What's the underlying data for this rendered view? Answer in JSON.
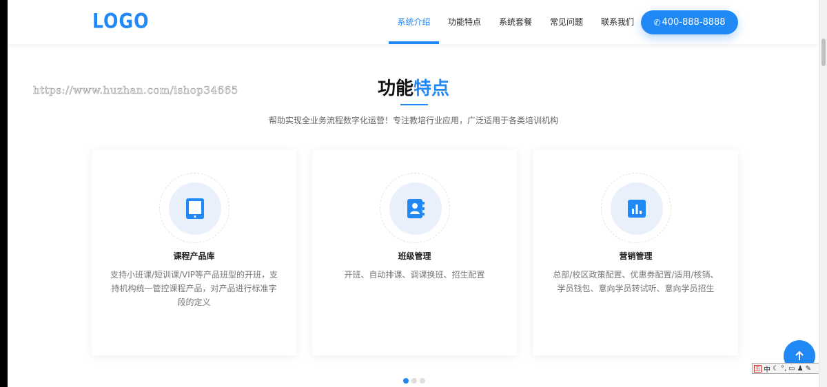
{
  "header": {
    "logo": "LOGO",
    "nav": [
      {
        "label": "系统介绍",
        "active": true
      },
      {
        "label": "功能特点",
        "active": false
      },
      {
        "label": "系统套餐",
        "active": false
      },
      {
        "label": "常见问题",
        "active": false
      },
      {
        "label": "联系我们",
        "active": false
      }
    ],
    "phone": "400-888-8888",
    "phone_icon": "phone-icon"
  },
  "watermark": "https://www.huzhan.com/ishop34665",
  "section": {
    "title_part1": "功能",
    "title_part2": "特点",
    "subtitle": "帮助实现全业务流程数字化运营！专注教培行业应用，广泛适用于各类培训机构"
  },
  "cards": [
    {
      "icon": "tablet-icon",
      "title": "课程产品库",
      "desc": "支持小班课/短训课/VIP等产品班型的开班，支持机构统一管控课程产品，对产品进行标准字段的定义"
    },
    {
      "icon": "contact-book-icon",
      "title": "班级管理",
      "desc": "开班、自动排课、调课换班、招生配置"
    },
    {
      "icon": "bar-chart-icon",
      "title": "营销管理",
      "desc": "总部/校区政策配置、优惠券配置/适用/核销、学员钱包、意向学员转试听、意向学员招生"
    }
  ],
  "pagination": {
    "total": 3,
    "active": 1
  },
  "ime": {
    "label": "中",
    "extra": "°,"
  },
  "colors": {
    "accent": "#2189f5",
    "icon_bg": "#e9f0fc"
  }
}
